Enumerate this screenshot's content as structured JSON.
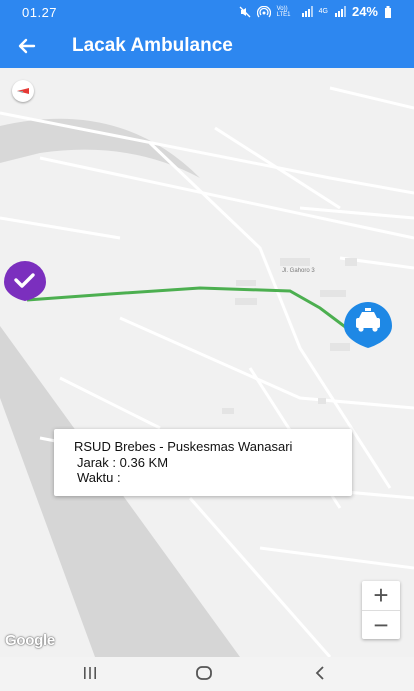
{
  "status_bar": {
    "time": "01.27",
    "icons": [
      "mute-icon",
      "hotspot-icon",
      "volte-icon",
      "signal-icon",
      "4g-signal-icon"
    ],
    "volte_label": "Vo)) LTE1",
    "network_label": "4G",
    "battery": "24%"
  },
  "app_bar": {
    "back_icon": "arrow-left-icon",
    "title": "Lacak Ambulance"
  },
  "map": {
    "street_label": "Jl. Gahoro 3",
    "route_color": "#4caf50",
    "origin_marker": {
      "icon": "check-icon",
      "color": "#7b2fbe"
    },
    "destination_marker": {
      "icon": "taxi-icon",
      "color": "#1e88e5"
    },
    "info_card": {
      "title": "RSUD Brebes - Puskesmas Wanasari",
      "distance": "Jarak : 0.36 KM",
      "time": "Waktu :"
    },
    "zoom_in_label": "+",
    "zoom_out_label": "−",
    "attribution": "Google"
  },
  "nav_bar": {
    "buttons": [
      "recent-apps-icon",
      "home-icon",
      "back-icon"
    ]
  },
  "colors": {
    "primary": "#2d87f0",
    "origin": "#7b2fbe",
    "destination": "#1e88e5",
    "route": "#4caf50"
  }
}
